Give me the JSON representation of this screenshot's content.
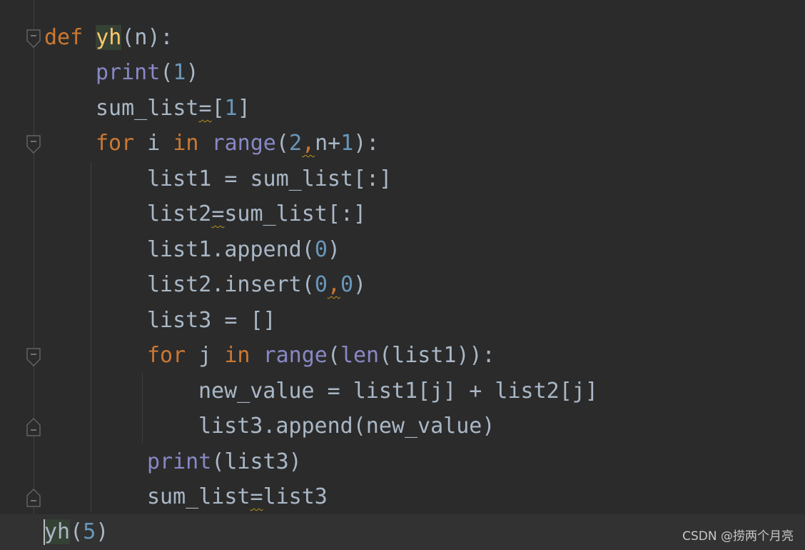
{
  "editor": {
    "language": "python",
    "colors": {
      "background": "#2b2b2b",
      "default_text": "#a9b7c6",
      "keyword": "#cc7832",
      "number": "#6897bb",
      "builtin": "#8888c6",
      "function_name": "#ffc66d",
      "warning_underline": "#be9117"
    },
    "lines": {
      "l1": {
        "t1": "def",
        "t2": " ",
        "t3": "yh",
        "t4": "(n):"
      },
      "l2": {
        "t1": "print",
        "t2": "(",
        "t3": "1",
        "t4": ")"
      },
      "l3": {
        "t1": "sum_list",
        "t2": "=",
        "t3": "[",
        "t4": "1",
        "t5": "]"
      },
      "l4": {
        "t1": "for",
        "t2": " i ",
        "t3": "in",
        "t4": " ",
        "t5": "range",
        "t6": "(",
        "t7": "2",
        "t8": ",",
        "t9": "n+",
        "t10": "1",
        "t11": "):"
      },
      "l5": {
        "t1": "list1 = sum_list[:]"
      },
      "l6": {
        "t1": "list2",
        "t2": "=",
        "t3": "sum_list[:]"
      },
      "l7": {
        "t1": "list1.append(",
        "t2": "0",
        "t3": ")"
      },
      "l8": {
        "t1": "list2.insert(",
        "t2": "0",
        "t3": ",",
        "t4": "0",
        "t5": ")"
      },
      "l9": {
        "t1": "list3 = []"
      },
      "l10": {
        "t1": "for",
        "t2": " j ",
        "t3": "in",
        "t4": " ",
        "t5": "range",
        "t6": "(",
        "t7": "len",
        "t8": "(list1)):"
      },
      "l11": {
        "t1": "new_value = list1[j] + list2[j]"
      },
      "l12": {
        "t1": "list3.append(new_value)"
      },
      "l13": {
        "t1": "print",
        "t2": "(list3)"
      },
      "l14": {
        "t1": "sum_list",
        "t2": "=",
        "t3": "list3"
      },
      "l15": {
        "t1": "yh",
        "t2": "(",
        "t3": "5",
        "t4": ")"
      }
    }
  },
  "watermark": {
    "text": "CSDN @捞两个月亮"
  }
}
